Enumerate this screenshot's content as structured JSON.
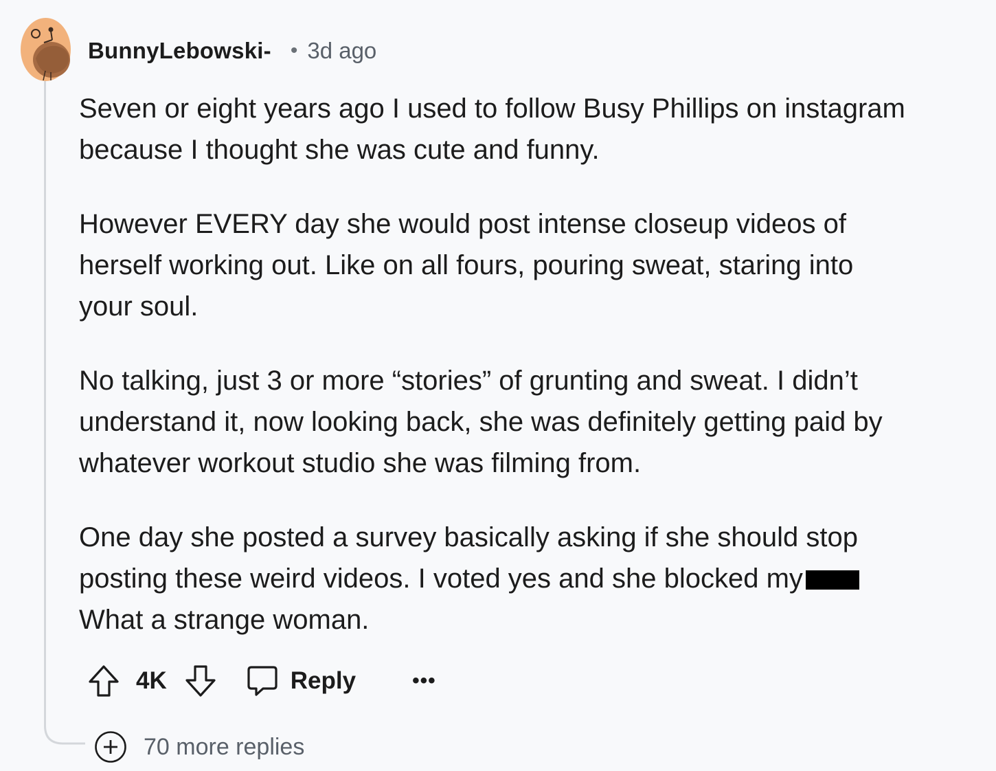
{
  "comment": {
    "username": "BunnyLebowski-",
    "separator": "•",
    "time_ago": "3d ago",
    "avatar_icon": "snoo-avatar-icon",
    "paragraphs": [
      {
        "lines": [
          "Seven or eight years ago I used to follow Busy Phillips on instagram",
          "because I thought she was cute and funny."
        ]
      },
      {
        "lines": [
          "However EVERY day she would post intense closeup videos of",
          "herself working out. Like on all fours, pouring sweat, staring into",
          "your soul."
        ]
      },
      {
        "lines": [
          "No talking, just 3 or more “stories” of grunting and sweat. I didn’t",
          "understand it, now looking back, she was definitely getting paid by",
          "whatever workout studio she was filming from."
        ]
      },
      {
        "lines": [
          "One day she posted a survey basically asking if she should stop",
          "posting these weird videos. I voted yes and she blocked my",
          "What a strange woman."
        ]
      }
    ]
  },
  "actions": {
    "upvote_icon": "upvote-arrow-icon",
    "score": "4K",
    "downvote_icon": "downvote-arrow-icon",
    "reply_icon": "speech-bubble-icon",
    "reply_label": "Reply",
    "more_label": "•••"
  },
  "more_replies": {
    "icon": "plus-circle-icon",
    "label": "70 more replies"
  },
  "colors": {
    "background": "#f8f9fb",
    "avatar_bg": "#f2b27c",
    "avatar_bear": "#a66b43",
    "muted_text": "#596069",
    "thread_line": "#d4d7db"
  }
}
